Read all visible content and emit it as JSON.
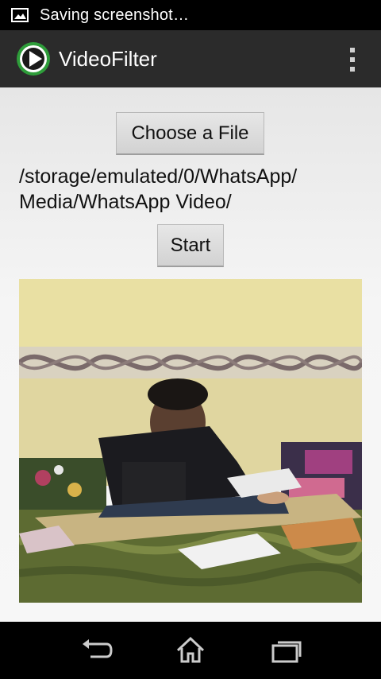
{
  "status_bar": {
    "notification_text": "Saving screenshot…",
    "notification_icon": "image-icon"
  },
  "action_bar": {
    "app_title": "VideoFilter",
    "app_icon": "play-circle-icon",
    "overflow_icon": "more-vertical-icon"
  },
  "main": {
    "choose_file_label": "Choose a File",
    "file_path": "/storage/emulated/0/WhatsApp/\nMedia/WhatsApp Video/",
    "start_label": "Start"
  },
  "nav_bar": {
    "back_icon": "back-icon",
    "home_icon": "home-icon",
    "recents_icon": "recents-icon"
  },
  "colors": {
    "accent_green": "#2e9d3a",
    "action_bar": "#2b2b2b",
    "content_bg": "#f2f2f2"
  }
}
